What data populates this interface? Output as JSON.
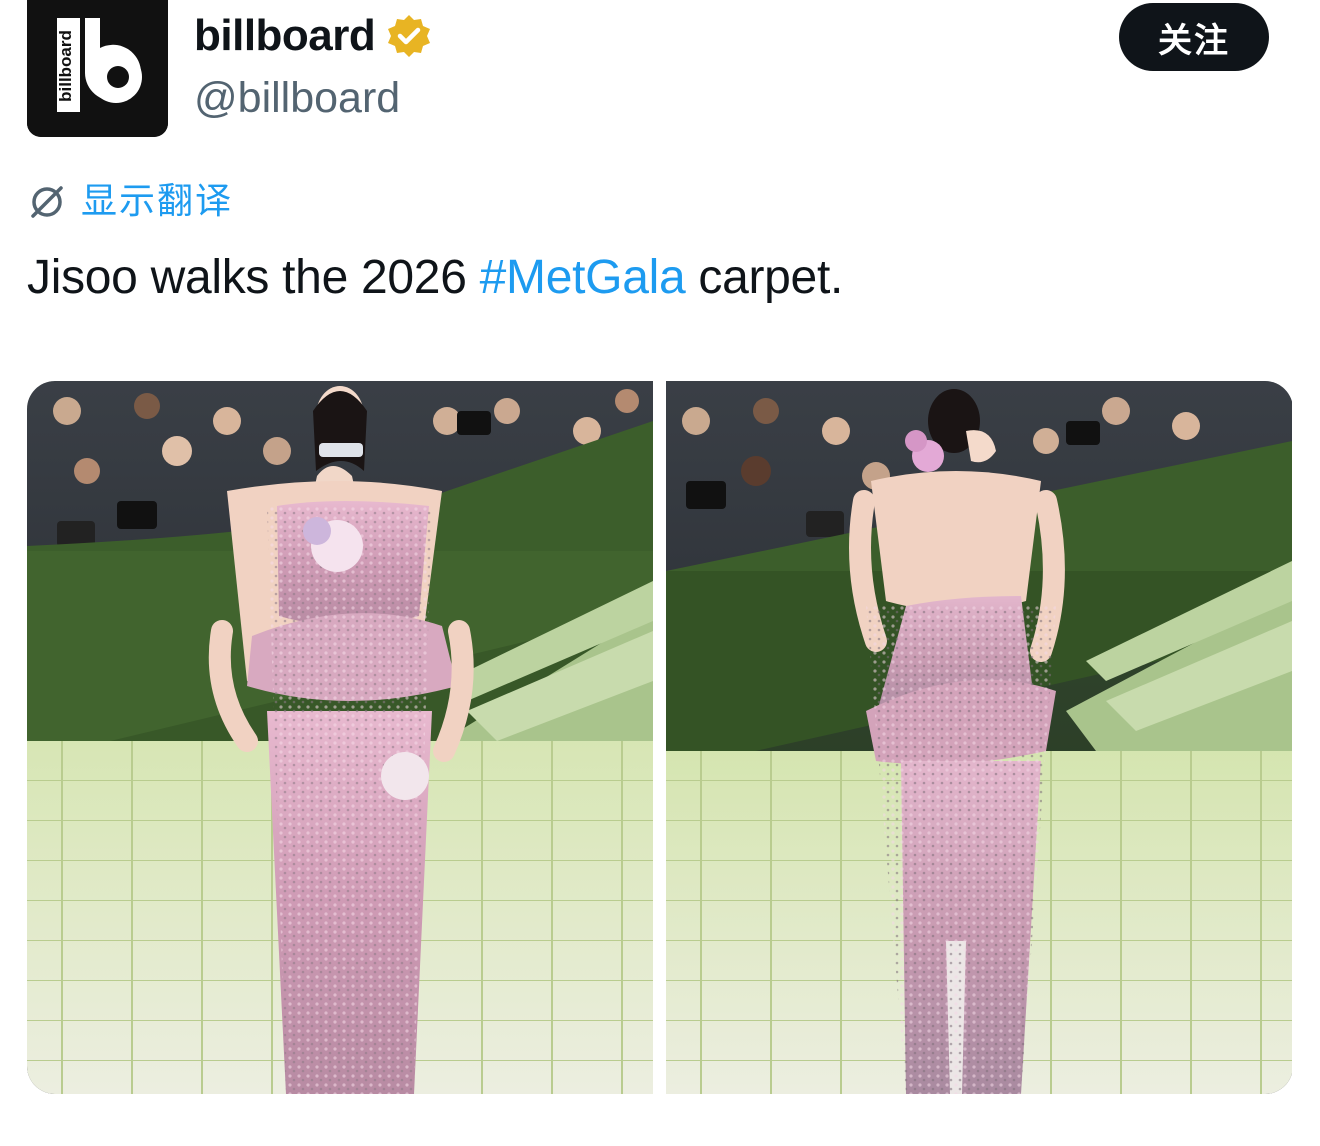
{
  "author": {
    "avatar_text": "billboard",
    "avatar_letter": "b",
    "display_name": "billboard",
    "handle": "@billboard",
    "verified": true,
    "verified_icon": "verified-badge-icon",
    "verified_color": "#e8b423"
  },
  "follow_button": {
    "label": "关注"
  },
  "translate": {
    "icon": "translate-icon",
    "label": "显示翻译"
  },
  "tweet": {
    "text_before": "Jisoo walks the 2026 ",
    "hashtag": "#MetGala",
    "text_after": " carpet."
  },
  "media": {
    "photo_count": 2,
    "photos": [
      {
        "content": "Jisoo in a pink sequined strapless gown, front view, on steps with photographers behind"
      },
      {
        "content": "Jisoo in a pink sequined backless gown, back view, on steps with photographers behind"
      }
    ]
  },
  "colors": {
    "accent": "#1d9bf0",
    "text": "#0f1419",
    "secondary": "#536471",
    "button_bg": "#0f1419"
  }
}
